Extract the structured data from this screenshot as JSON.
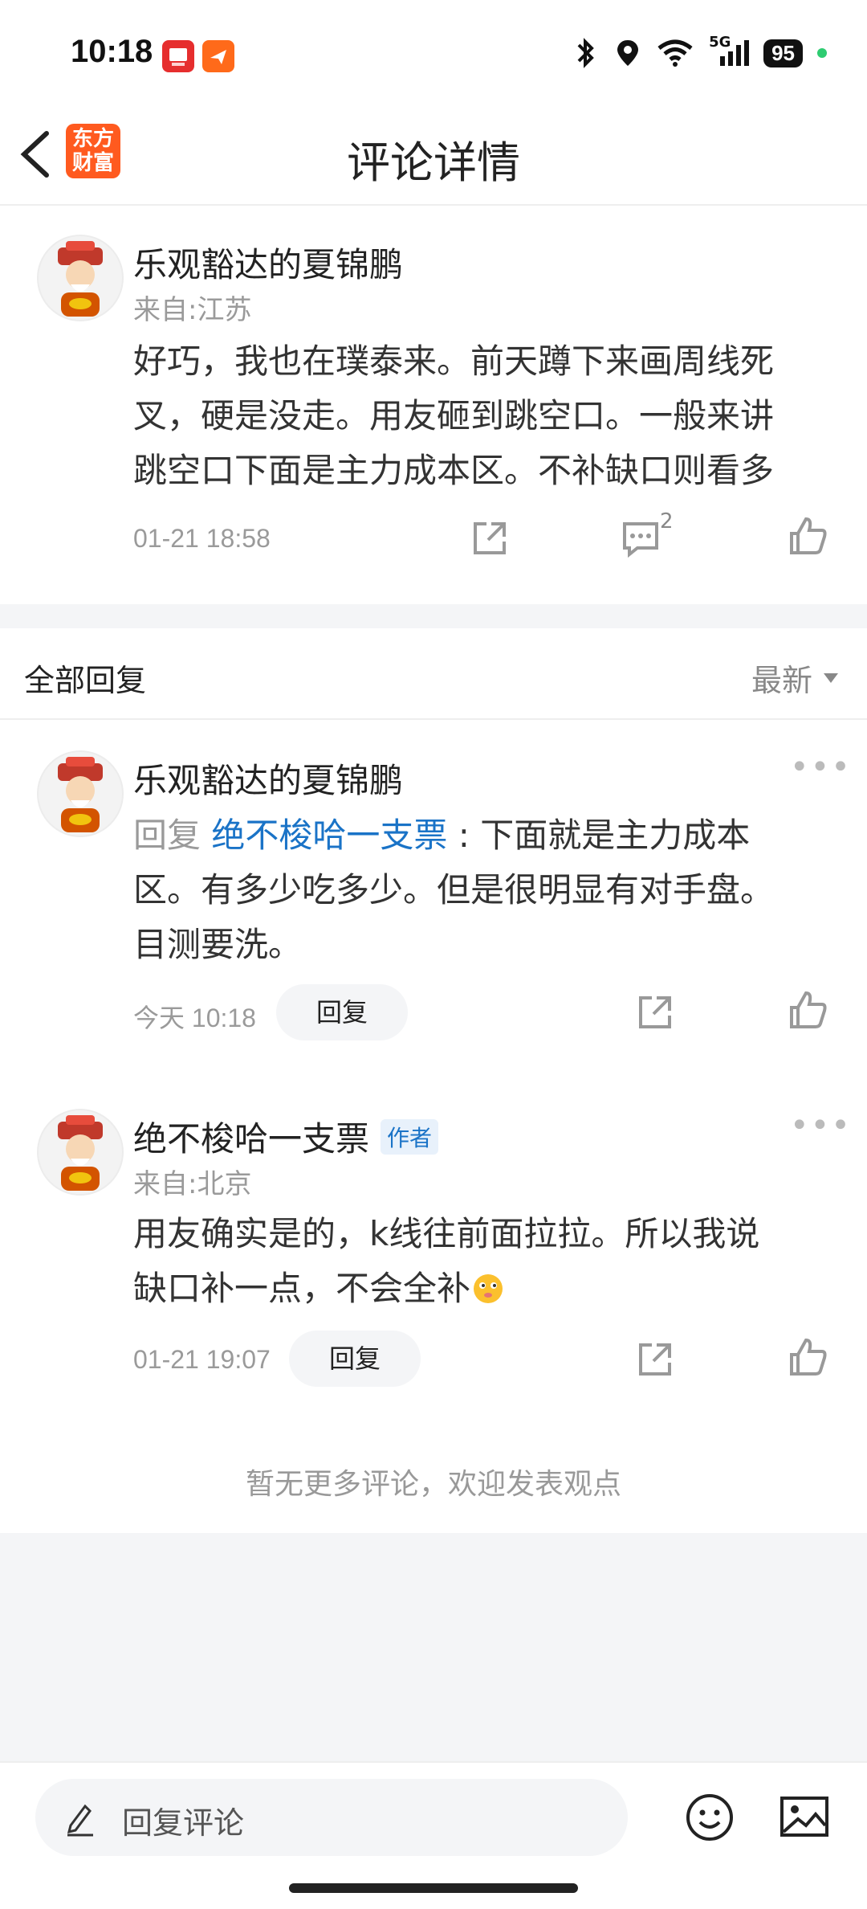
{
  "status_bar": {
    "time": "10:18",
    "battery": "95",
    "network": "5G"
  },
  "header": {
    "title": "评论详情",
    "logo_line1": "东方",
    "logo_line2": "财富"
  },
  "main_comment": {
    "author": "乐观豁达的夏锦鹏",
    "location": "来自:江苏",
    "lines": [
      "好巧，我也在璞泰来。前天蹲下来画周线死",
      "叉，硬是没走。用友砸到跳空口。一般来讲",
      "跳空口下面是主力成本区。不补缺口则看多"
    ],
    "timestamp": "01-21 18:58",
    "comment_count": "2"
  },
  "replies_section": {
    "title": "全部回复",
    "sort": "最新"
  },
  "replies": [
    {
      "author": "乐观豁达的夏锦鹏",
      "reply_prefix": "回复",
      "reply_to": "绝不梭哈一支票",
      "colon": ":",
      "lines": [
        "下面就是主力成本",
        "区。有多少吃多少。但是很明显有对手盘。",
        "目测要洗。"
      ],
      "timestamp": "今天 10:18",
      "reply_button": "回复"
    },
    {
      "author": "绝不梭哈一支票",
      "author_tag": "作者",
      "location": "来自:北京",
      "lines": [
        "用友确实是的，k线往前面拉拉。所以我说",
        "缺口补一点，不会全补"
      ],
      "timestamp": "01-21 19:07",
      "reply_button": "回复"
    }
  ],
  "footer_note": "暂无更多评论，欢迎发表观点",
  "bottom_bar": {
    "placeholder": "回复评论"
  },
  "icons": {
    "share": "share-icon",
    "comment": "comment-icon",
    "like": "thumbs-up-icon",
    "emoji": "emoji-icon",
    "image": "image-icon",
    "edit": "pencil-icon"
  },
  "colors": {
    "accent_blue": "#1a73c7",
    "brand_orange": "#ff5a1f"
  }
}
